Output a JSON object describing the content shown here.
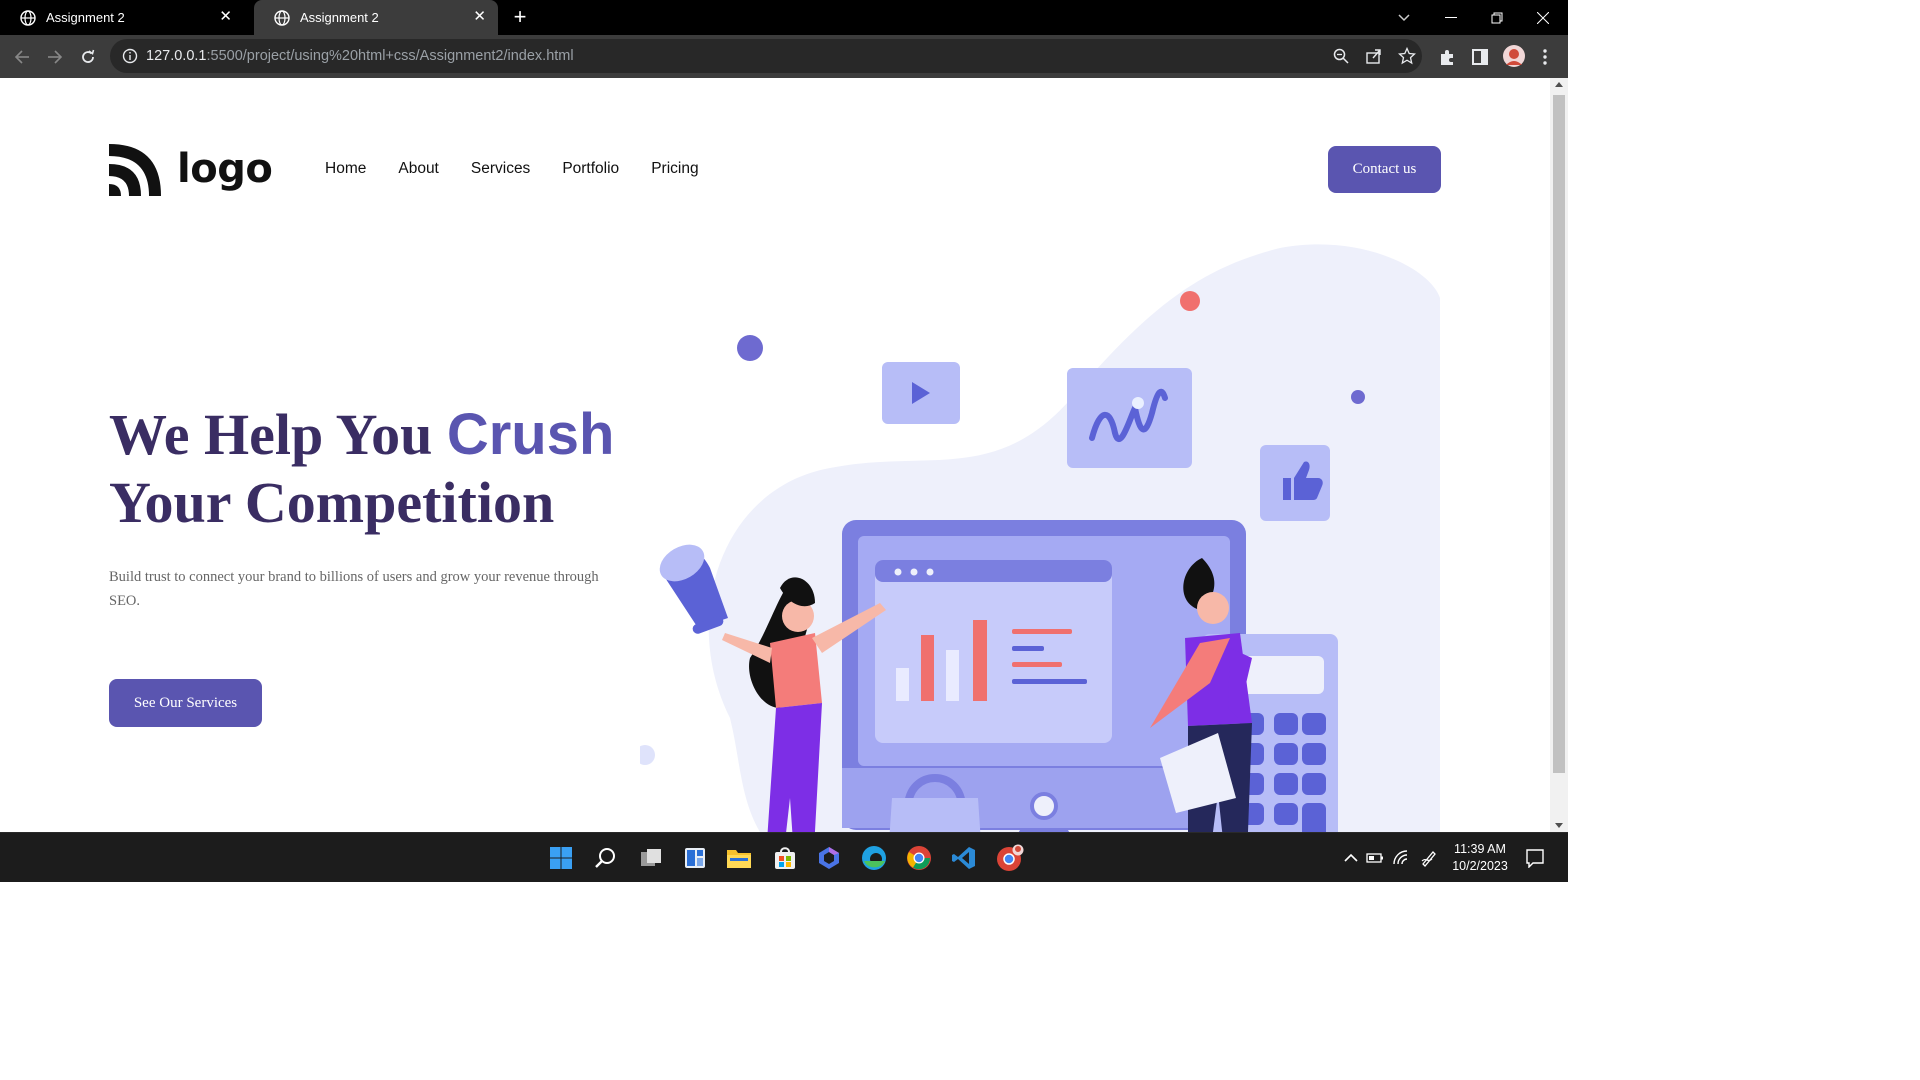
{
  "browser": {
    "tabs": [
      {
        "title": "Assignment 2",
        "active": false
      },
      {
        "title": "Assignment 2",
        "active": true
      }
    ],
    "url_host": "127.0.0.1",
    "url_rest": ":5500/project/using%20html+css/Assignment2/index.html"
  },
  "site": {
    "logo_text": "logo",
    "nav": [
      "Home",
      "About",
      "Services",
      "Portfolio",
      "Pricing"
    ],
    "contact_label": "Contact us",
    "hero": {
      "title_part1": "We Help You ",
      "title_accent": "Crush",
      "title_part2": "Your Competition",
      "subtitle": "Build trust to connect your brand to billions of users and grow your revenue through SEO.",
      "cta_label": "See Our Services"
    }
  },
  "taskbar": {
    "time": "11:39 AM",
    "date": "10/2/2023"
  },
  "colors": {
    "accent": "#5a55b0",
    "heading": "#3a2d63",
    "blob": "#eef0ff",
    "illustration_blue": "#7b7fe0",
    "illustration_coral": "#f0706e"
  }
}
